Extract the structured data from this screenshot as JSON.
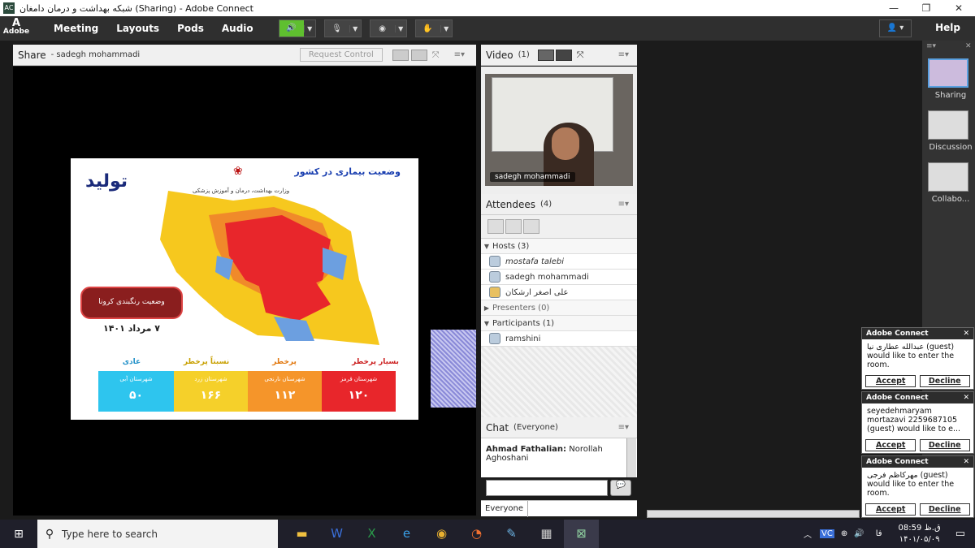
{
  "window": {
    "title": "شبکه بهداشت و درمان دامغان (Sharing) - Adobe Connect",
    "minimize": "—",
    "maximize": "❐",
    "close": "✕"
  },
  "menubar": {
    "logo": "Adobe",
    "items": [
      "Meeting",
      "Layouts",
      "Pods",
      "Audio"
    ],
    "help": "Help"
  },
  "share_pod": {
    "title": "Share",
    "presenter": "- sadegh mohammadi",
    "request_control": "Request Control"
  },
  "slide": {
    "title": "وضعیت بیماری در کشور",
    "ministry": "وزارت بهداشت، درمان و آموزش پزشکی",
    "logo_text": "تولید",
    "date": "۷ مرداد ۱۴۰۱",
    "banner": "وضعیت رنگبندی کرونا",
    "legend": [
      {
        "label": "بسیار پرخطر",
        "sub": "شهرستان قرمز",
        "value": "۱۲۰",
        "color": "#e8262b"
      },
      {
        "label": "پرخطر",
        "sub": "شهرستان نارنجی",
        "value": "۱۱۲",
        "color": "#f5952a"
      },
      {
        "label": "نسبتاً پرخطر",
        "sub": "شهرستان زرد",
        "value": "۱۶۶",
        "color": "#f5d02a"
      },
      {
        "label": "عادی",
        "sub": "شهرستان آبی",
        "value": "۵۰",
        "color": "#2ec5ee"
      }
    ]
  },
  "video_pod": {
    "title": "Video",
    "count": "(1)",
    "name": "sadegh mohammadi"
  },
  "attendees_pod": {
    "title": "Attendees",
    "count": "(4)",
    "hosts_label": "Hosts (3)",
    "hosts": [
      "mostafa talebi",
      "sadegh mohammadi",
      "علی اصغر ارشکان"
    ],
    "presenters_label": "Presenters (0)",
    "participants_label": "Participants (1)",
    "participants": [
      "ramshini"
    ]
  },
  "chat_pod": {
    "title": "Chat",
    "scope": "(Everyone)",
    "sender": "Ahmad Fathalian:",
    "message": "Norollah Aghoshani",
    "send_to": "Everyone"
  },
  "layouts": [
    "Sharing",
    "Discussion",
    "Collabo..."
  ],
  "notices": [
    {
      "header": "Adobe Connect",
      "body": "عبدالله عطاری نیا (guest) would like to enter the room.",
      "accept": "Accept",
      "decline": "Decline"
    },
    {
      "header": "Adobe Connect",
      "body": "seyedehmaryam mortazavi 2259687105 (guest) would like to e...",
      "accept": "Accept",
      "decline": "Decline"
    },
    {
      "header": "Adobe Connect",
      "body": "مهرکاظم فرجی (guest) would like to enter the room.",
      "accept": "Accept",
      "decline": "Decline"
    }
  ],
  "taskbar": {
    "search_placeholder": "Type here to search",
    "time": "08:59 ق.ظ",
    "date": "۱۴۰۱/۰۵/۰۹",
    "lang": "فا"
  }
}
